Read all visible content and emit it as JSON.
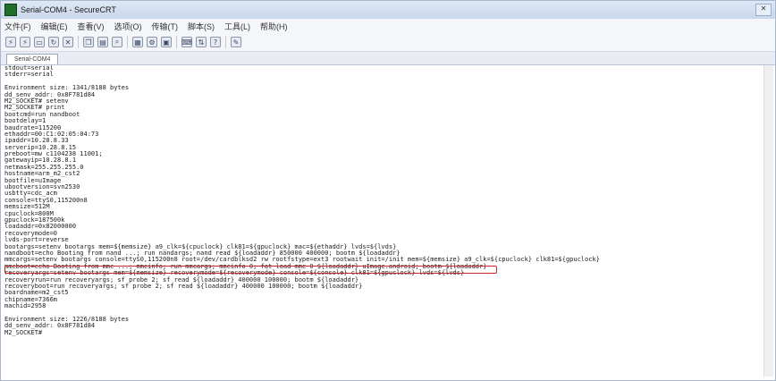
{
  "window": {
    "title": "Serial-COM4 - SecureCRT",
    "close_glyph": "✕"
  },
  "menu": [
    "文件(F)",
    "编辑(E)",
    "查看(V)",
    "选项(O)",
    "传输(T)",
    "脚本(S)",
    "工具(L)",
    "帮助(H)"
  ],
  "toolbar_icons": [
    "connect-icon",
    "quick-connect-icon",
    "connect-tab-icon",
    "reconnect-icon",
    "disconnect-icon",
    "copy-icon",
    "paste-icon",
    "find-icon",
    "print-icon",
    "settings-icon",
    "session-options-icon",
    "keymap-icon",
    "sftp-icon",
    "help-icon",
    "script-icon"
  ],
  "tab": {
    "label": "Serial-COM4"
  },
  "terminal": {
    "lines": [
      "stdout=serial",
      "stderr=serial",
      "",
      "Environment size: 1341/8188 bytes",
      "dd_senv_addr: 0x8F781d84",
      "M2_SOCKET# setenv",
      "M2_SOCKET# print",
      "bootcmd=run nandboot",
      "bootdelay=1",
      "baudrate=115200",
      "ethaddr=00:C1:02:05:04:73",
      "ipaddr=10.28.8.33",
      "serverip=10.28.8.15",
      "preboot=mw c1104238 11001;",
      "gatewayip=10.28.8.1",
      "netmask=255.255.255.0",
      "hostname=arm_m2_cst2",
      "bootfile=uImage",
      "ubootversion=svn2530",
      "usbtty=cdc_acm",
      "console=ttyS0,115200n8",
      "memsize=512M",
      "cpuclock=800M",
      "gpuclock=187500k",
      "loadaddr=0x82000000",
      "recoverymode=0",
      "lvds-port=reverse",
      "bootargs=setenv bootargs mem=${memsize} a9_clk=${cpuclock} clk81=${gpuclock} mac=${ethaddr} lvds=${lvds}",
      "nandboot=echo Booting from nand ...; run nandargs; nand read ${loadaddr} 850000 400000; bootm ${loadaddr}",
      "mmcargs=setenv bootargs console=ttyS0,115200n8 root=/dev/cardblksd2 rw rootfstype=ext3 rootwait init=/init mem=${memsize} a9_clk=${cpuclock} clk81=${gpuclock}",
      "mmcboot=echo Booting from mmc ...; mmcinfo; run mmcargs; mmcinfo 0; fat load mmc 0 ${loadaddr} uImage.android; bootm ${loadaddr}",
      "recoveryargs=setenv bootargs mem=${memsize} recoverymode=${recoverymode} console=${console} clk81=${gpuclock} lvds=${lvds}",
      "recoveryrun=run recoveryargs; sf probe 2; sf read ${loadaddr} 400000 100000; bootm ${loadaddr}",
      "recoveryboot=run recoveryargs; sf probe 2; sf read ${loadaddr} 400000 100000; bootm ${loadaddr}",
      "boardname=m2_cst5",
      "chipname=7366m",
      "machid=2958",
      "",
      "Environment size: 1226/8188 bytes",
      "dd_senv_addr: 0x8F781d84",
      "M2_SOCKET#"
    ]
  }
}
